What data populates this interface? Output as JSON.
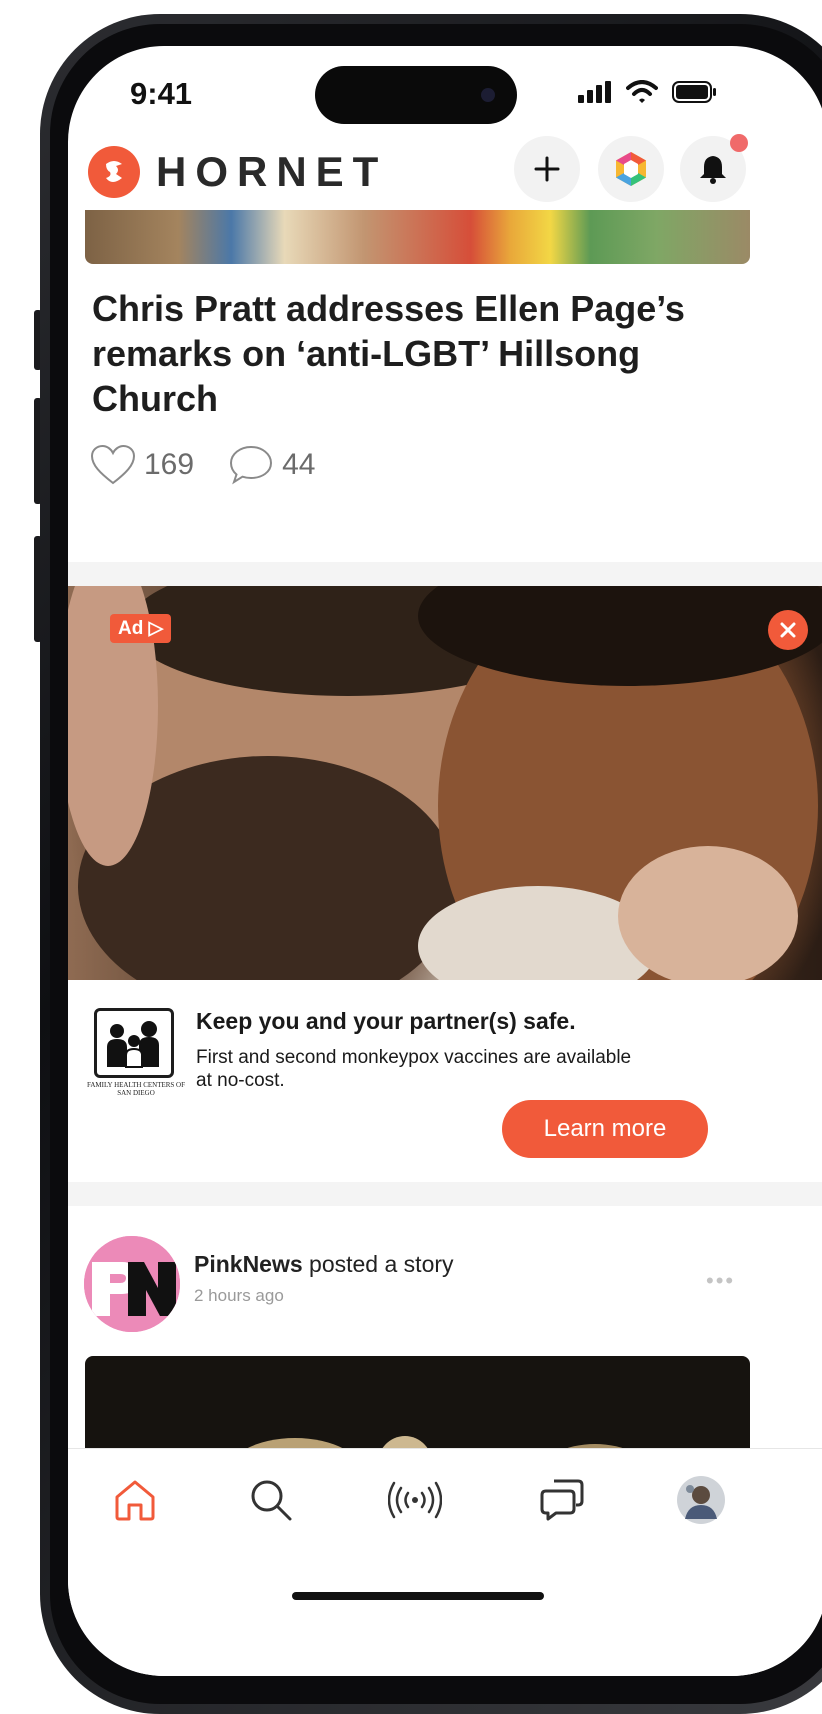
{
  "status_bar": {
    "time": "9:41"
  },
  "header": {
    "app_name": "HORNET",
    "icons": [
      "plus-icon",
      "hexagon-icon",
      "bell-icon"
    ],
    "has_notification": true
  },
  "article": {
    "title": "Chris Pratt addresses Ellen Page’s remarks on ‘anti-LGBT’ Hillsong Church",
    "likes": "169",
    "comments": "44"
  },
  "ad": {
    "badge": "Ad",
    "advertiser": "FAMILY HEALTH CENTERS OF SAN DIEGO",
    "headline": "Keep you and your partner(s) safe.",
    "body": "First and second monkeypox vaccines are available at no-cost.",
    "cta": "Learn more"
  },
  "post": {
    "author": "PinkNews",
    "action": " posted a story",
    "time": "2 hours ago",
    "avatar_text": "PN"
  },
  "tabbar": {
    "items": [
      "home-icon",
      "search-icon",
      "live-icon",
      "chat-icon",
      "profile-avatar"
    ],
    "active": "home-icon"
  },
  "colors": {
    "accent": "#f15a3a",
    "text": "#1e1e1e",
    "muted": "#6b6b6b",
    "pink": "#ec8ab8"
  }
}
